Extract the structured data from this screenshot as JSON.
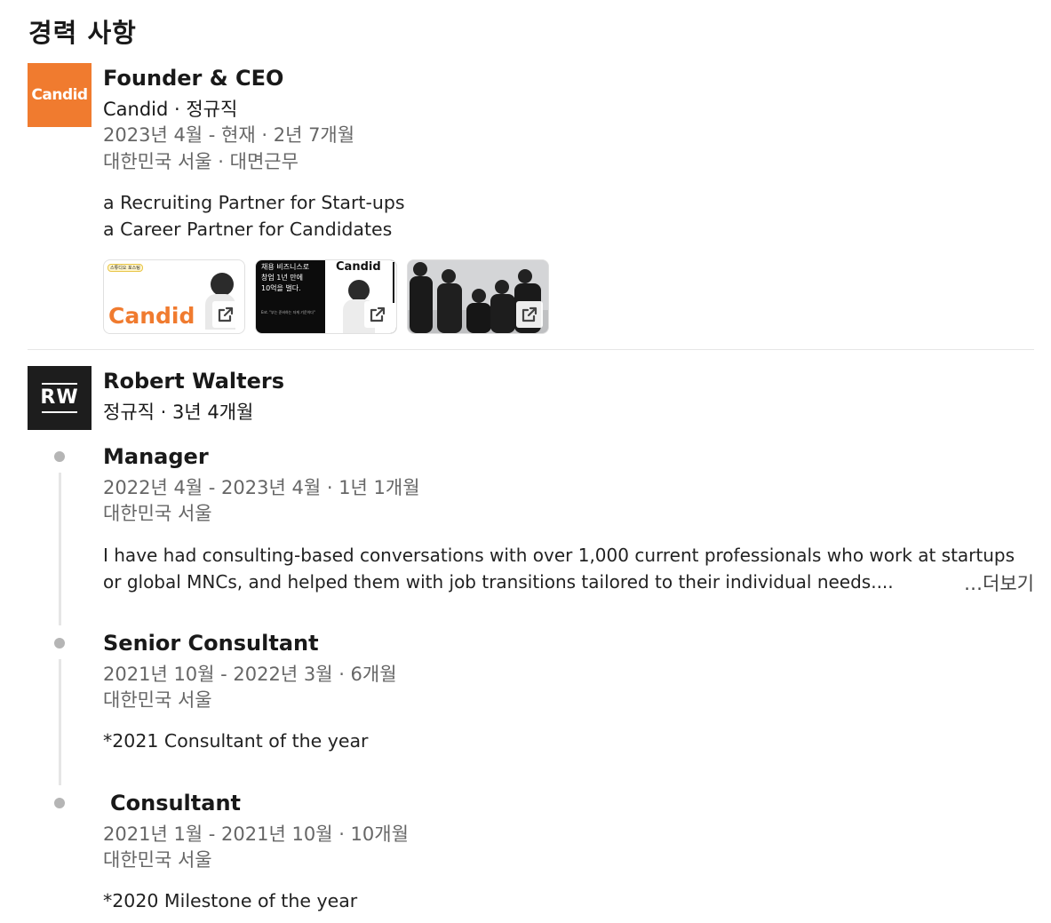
{
  "section": {
    "title": "경력 사항"
  },
  "candid": {
    "logo_text": "Candid",
    "title": "Founder & CEO",
    "company_type": "Candid · 정규직",
    "dates": "2023년 4월 - 현재 · 2년 7개월",
    "location": "대한민국 서울 · 대면근무",
    "desc": [
      "a Recruiting Partner for Start-ups",
      "a Career Partner for Candidates"
    ],
    "media": [
      {
        "badge": "스튜디오 포스팅",
        "brand": "Candid"
      },
      {
        "headline": [
          "채용 비즈니스로",
          "창업 1년 만에",
          "10억을 벌다."
        ],
        "sub": "Ent. \"부는 준비하는 자게 기운이다\"",
        "brand": "Candid"
      },
      {
        "kind": "photo"
      }
    ]
  },
  "robert": {
    "logo_text": "RW",
    "company": "Robert Walters",
    "type_duration": "정규직 · 3년 4개월",
    "roles": [
      {
        "title": "Manager",
        "dates": "2022년 4월 - 2023년 4월 · 1년 1개월",
        "location": "대한민국 서울",
        "desc": [
          "I have had consulting-based conversations with over 1,000 current professionals who work at startups",
          "or global MNCs, and helped them with job transitions tailored to their individual needs...."
        ],
        "more": "…더보기"
      },
      {
        "title": "Senior Consultant",
        "dates": "2021년 10월 - 2022년 3월 · 6개월",
        "location": "대한민국 서울",
        "desc": [
          "*2021 Consultant of the year"
        ]
      },
      {
        "title": "Consultant",
        "dates": "2021년 1월 - 2021년 10월 · 10개월",
        "location": "대한민국 서울",
        "desc": [
          "*2020 Milestone of the year"
        ]
      }
    ]
  },
  "colors": {
    "candid_orange": "#f07b2f",
    "rw_dark": "#1d1d1d",
    "meta_gray": "#666666",
    "timeline_gray": "#b5b5b5"
  },
  "icons": {
    "external": "external-link-icon",
    "timeline": "timeline-dot-icon"
  }
}
